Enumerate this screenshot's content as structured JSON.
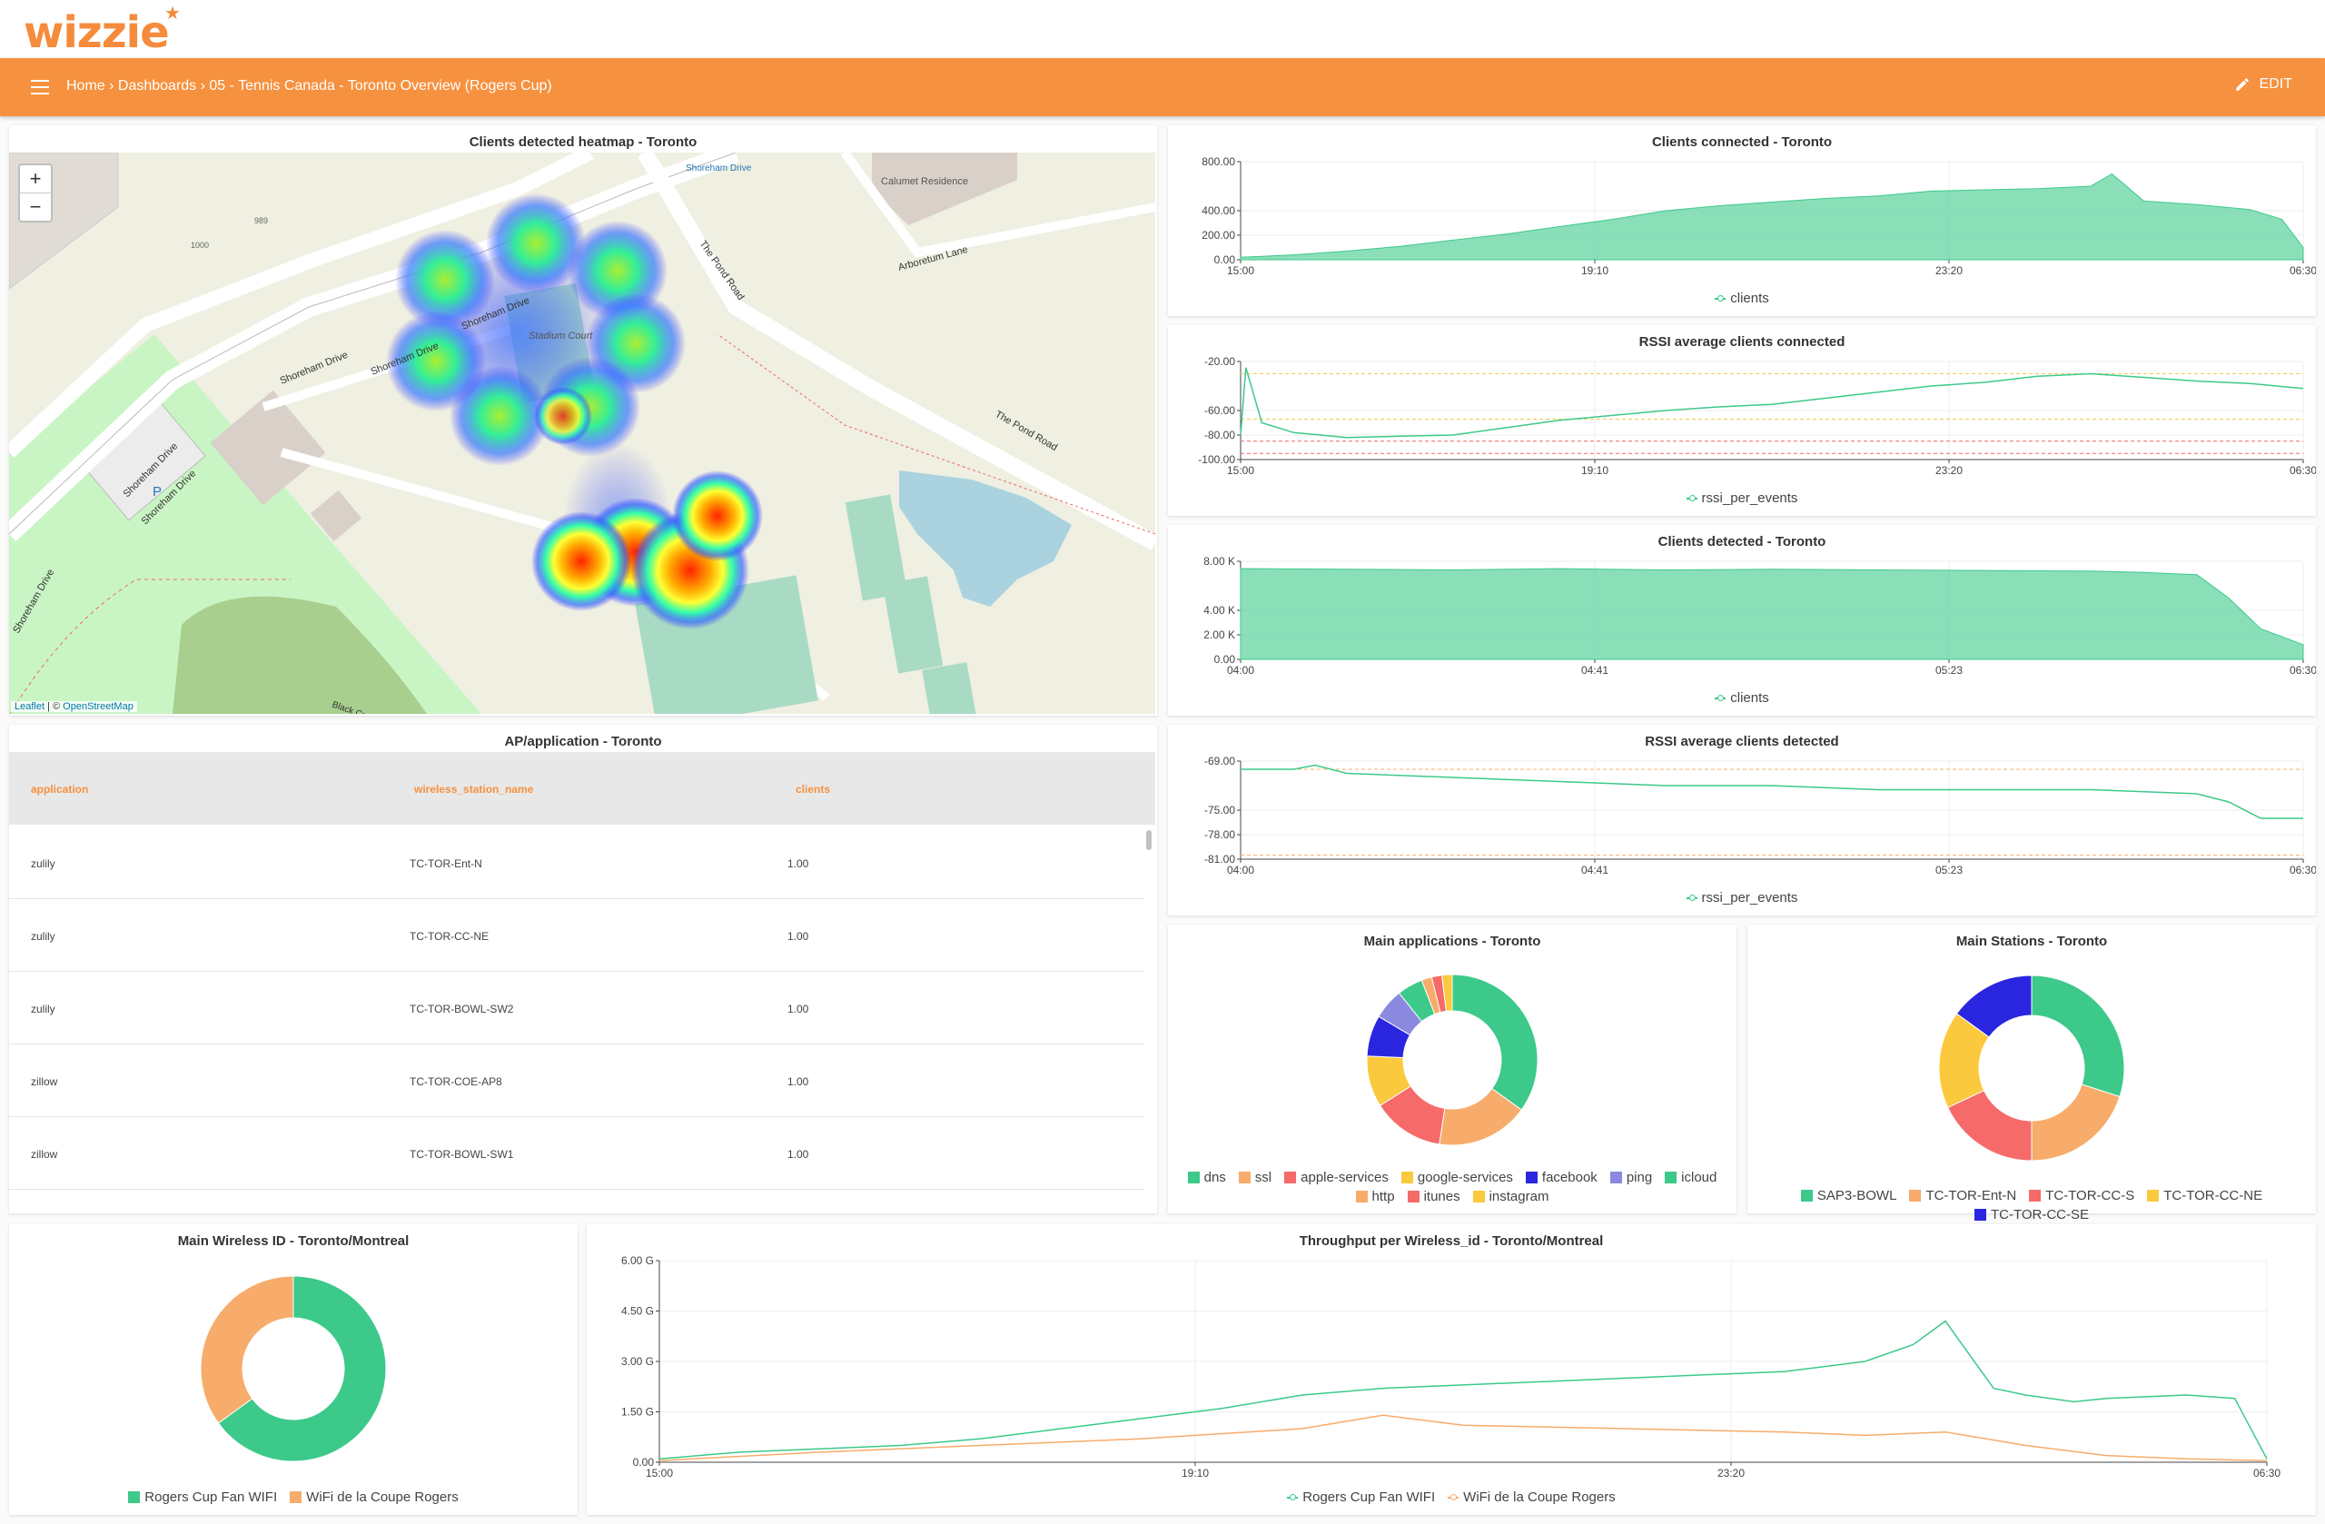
{
  "brand": {
    "logo": "wizzie",
    "accent": "#f6913f"
  },
  "header": {
    "breadcrumb": "Home › Dashboards › 05 - Tennis Canada - Toronto Overview (Rogers Cup)",
    "edit_label": "EDIT"
  },
  "map_panel": {
    "title": "Clients detected heatmap - Toronto",
    "zoom_in": "+",
    "zoom_out": "−",
    "attribution_leaflet": "Leaflet",
    "attribution_sep": " | © ",
    "attribution_osm": "OpenStreetMap",
    "labels": {
      "shoreham1": "Shoreham Drive",
      "shoreham2": "Shoreham Drive",
      "shoreham3": "Shoreham Drive",
      "shoreham4": "Shoreham Drive",
      "shoreham5": "Shoreham Drive",
      "shoreham6": "Shoreham Drive",
      "shoreham_stop": "Shoreham Drive",
      "calumet": "Calumet Residence",
      "arboretum": "Arboretum Lane",
      "pond1": "The Pond Road",
      "pond2": "The Pond Road",
      "stadium": "Stadium Court",
      "parking": "P",
      "block": "Black Creek",
      "num1000": "1000",
      "num989": "989"
    }
  },
  "table_panel": {
    "title": "AP/application - Toronto",
    "columns": [
      "application",
      "wireless_station_name",
      "clients"
    ],
    "rows": [
      [
        "zulily",
        "TC-TOR-Ent-N",
        "1.00"
      ],
      [
        "zulily",
        "TC-TOR-CC-NE",
        "1.00"
      ],
      [
        "zulily",
        "TC-TOR-BOWL-SW2",
        "1.00"
      ],
      [
        "zillow",
        "TC-TOR-COE-AP8",
        "1.00"
      ],
      [
        "zillow",
        "TC-TOR-BOWL-SW1",
        "1.00"
      ]
    ]
  },
  "charts": {
    "clients_connected": {
      "title": "Clients connected - Toronto",
      "legend": "clients"
    },
    "rssi_connected": {
      "title": "RSSI average clients connected",
      "legend": "rssi_per_events"
    },
    "clients_detected": {
      "title": "Clients detected - Toronto",
      "legend": "clients"
    },
    "rssi_detected": {
      "title": "RSSI average clients detected",
      "legend": "rssi_per_events"
    },
    "main_apps": {
      "title": "Main applications - Toronto"
    },
    "main_stations": {
      "title": "Main Stations - Toronto"
    },
    "main_wireless": {
      "title": "Main Wireless ID - Toronto/Montreal"
    },
    "throughput": {
      "title": "Throughput per Wireless_id - Toronto/Montreal"
    }
  },
  "chart_data": [
    {
      "id": "clients_connected",
      "type": "area",
      "title": "Clients connected - Toronto",
      "x_ticks": [
        "15:00",
        "19:10",
        "23:20",
        "06:30"
      ],
      "y_ticks": [
        "800.00",
        "400.00",
        "200.00",
        "0.00"
      ],
      "ylim": [
        0,
        800
      ],
      "series": [
        {
          "name": "clients",
          "color": "#3cc98a",
          "x": [
            0,
            0.05,
            0.1,
            0.15,
            0.2,
            0.25,
            0.3,
            0.35,
            0.4,
            0.45,
            0.5,
            0.55,
            0.6,
            0.65,
            0.7,
            0.75,
            0.8,
            0.82,
            0.85,
            0.9,
            0.95,
            0.98,
            1
          ],
          "values": [
            20,
            40,
            70,
            110,
            160,
            210,
            270,
            330,
            400,
            440,
            470,
            500,
            520,
            560,
            570,
            580,
            600,
            700,
            480,
            450,
            410,
            330,
            100
          ]
        }
      ]
    },
    {
      "id": "rssi_connected",
      "type": "line",
      "title": "RSSI average clients connected",
      "x_ticks": [
        "15:00",
        "19:10",
        "23:20",
        "06:30"
      ],
      "y_ticks": [
        "-20.00",
        "-60.00",
        "-80.00",
        "-100.00"
      ],
      "ylim": [
        -100,
        -20
      ],
      "series": [
        {
          "name": "rssi_per_events",
          "color": "#3cc98a",
          "x": [
            0,
            0.005,
            0.02,
            0.05,
            0.1,
            0.15,
            0.2,
            0.25,
            0.3,
            0.35,
            0.4,
            0.45,
            0.5,
            0.55,
            0.6,
            0.65,
            0.7,
            0.75,
            0.8,
            0.85,
            0.9,
            0.95,
            1
          ],
          "values": [
            -80,
            -25,
            -70,
            -78,
            -82,
            -81,
            -80,
            -74,
            -68,
            -64,
            -60,
            -57,
            -55,
            -50,
            -45,
            -40,
            -37,
            -32,
            -30,
            -33,
            -36,
            -38,
            -42
          ]
        }
      ]
    },
    {
      "id": "clients_detected",
      "type": "area",
      "title": "Clients detected - Toronto",
      "x_ticks": [
        "04:00",
        "04:41",
        "05:23",
        "06:30"
      ],
      "y_ticks": [
        "8.00 K",
        "4.00 K",
        "2.00 K",
        "0.00"
      ],
      "ylim": [
        0,
        8000
      ],
      "series": [
        {
          "name": "clients",
          "color": "#3cc98a",
          "x": [
            0,
            0.1,
            0.2,
            0.3,
            0.4,
            0.5,
            0.6,
            0.7,
            0.8,
            0.85,
            0.9,
            0.93,
            0.96,
            1
          ],
          "values": [
            7400,
            7350,
            7300,
            7400,
            7300,
            7350,
            7300,
            7250,
            7200,
            7100,
            6900,
            5000,
            2500,
            1200
          ]
        }
      ]
    },
    {
      "id": "rssi_detected",
      "type": "line",
      "title": "RSSI average clients detected",
      "x_ticks": [
        "04:00",
        "04:41",
        "05:23",
        "06:30"
      ],
      "y_ticks": [
        "-69.00",
        "-75.00",
        "-78.00",
        "-81.00"
      ],
      "ylim": [
        -81,
        -69
      ],
      "series": [
        {
          "name": "rssi_per_events",
          "color": "#3cc98a",
          "x": [
            0,
            0.05,
            0.07,
            0.1,
            0.2,
            0.3,
            0.4,
            0.5,
            0.6,
            0.7,
            0.8,
            0.9,
            0.93,
            0.96,
            1
          ],
          "values": [
            -70,
            -70,
            -69.5,
            -70.5,
            -71,
            -71.5,
            -72,
            -72,
            -72.5,
            -72.5,
            -72.5,
            -73,
            -74,
            -76,
            -76
          ]
        }
      ]
    },
    {
      "id": "main_apps",
      "type": "pie",
      "title": "Main applications - Toronto",
      "series": [
        {
          "name": "",
          "labels": [
            "dns",
            "ssl",
            "apple-services",
            "google-services",
            "facebook",
            "ping",
            "icloud",
            "http",
            "itunes",
            "instagram"
          ],
          "values": [
            36,
            18,
            14,
            10,
            8,
            6,
            5,
            2,
            2,
            2
          ],
          "colors": [
            "#3cc98a",
            "#f7ac6b",
            "#f66a6a",
            "#fbc93d",
            "#2a26e0",
            "#8b88e0",
            "#3cc98a",
            "#f7ac6b",
            "#f66a6a",
            "#fbc93d"
          ]
        }
      ]
    },
    {
      "id": "main_stations",
      "type": "pie",
      "title": "Main Stations - Toronto",
      "series": [
        {
          "name": "",
          "labels": [
            "SAP3-BOWL",
            "TC-TOR-Ent-N",
            "TC-TOR-CC-S",
            "TC-TOR-CC-NE",
            "TC-TOR-CC-SE"
          ],
          "values": [
            30,
            20,
            18,
            17,
            15
          ],
          "colors": [
            "#3cc98a",
            "#f7ac6b",
            "#f66a6a",
            "#fbc93d",
            "#2a26e0"
          ]
        }
      ]
    },
    {
      "id": "main_wireless",
      "type": "pie",
      "title": "Main Wireless ID - Toronto/Montreal",
      "series": [
        {
          "name": "",
          "labels": [
            "Rogers Cup Fan WIFI",
            "WiFi de la Coupe Rogers"
          ],
          "values": [
            65,
            35
          ],
          "colors": [
            "#3cc98a",
            "#f7ac6b"
          ]
        }
      ]
    },
    {
      "id": "throughput",
      "type": "line",
      "title": "Throughput per Wireless_id - Toronto/Montreal",
      "x_ticks": [
        "15:00",
        "19:10",
        "23:20",
        "06:30"
      ],
      "y_ticks": [
        "6.00 G",
        "4.50 G",
        "3.00 G",
        "1.50 G",
        "0.00"
      ],
      "ylim": [
        0,
        6
      ],
      "series": [
        {
          "name": "Rogers Cup Fan WIFI",
          "color": "#3cc98a",
          "x": [
            0,
            0.05,
            0.1,
            0.15,
            0.2,
            0.25,
            0.3,
            0.35,
            0.4,
            0.45,
            0.5,
            0.55,
            0.6,
            0.65,
            0.7,
            0.75,
            0.78,
            0.8,
            0.83,
            0.85,
            0.88,
            0.9,
            0.95,
            0.98,
            1
          ],
          "values": [
            0.1,
            0.3,
            0.4,
            0.5,
            0.7,
            1.0,
            1.3,
            1.6,
            2.0,
            2.2,
            2.3,
            2.4,
            2.5,
            2.6,
            2.7,
            3.0,
            3.5,
            4.2,
            2.2,
            2.0,
            1.8,
            1.9,
            2.0,
            1.9,
            0.1
          ]
        },
        {
          "name": "WiFi de la Coupe Rogers",
          "color": "#f7ac6b",
          "x": [
            0,
            0.1,
            0.2,
            0.3,
            0.4,
            0.45,
            0.5,
            0.6,
            0.7,
            0.75,
            0.8,
            0.85,
            0.9,
            0.95,
            1
          ],
          "values": [
            0.05,
            0.3,
            0.5,
            0.7,
            1.0,
            1.4,
            1.1,
            1.0,
            0.9,
            0.8,
            0.9,
            0.5,
            0.2,
            0.1,
            0.05
          ]
        }
      ]
    }
  ]
}
